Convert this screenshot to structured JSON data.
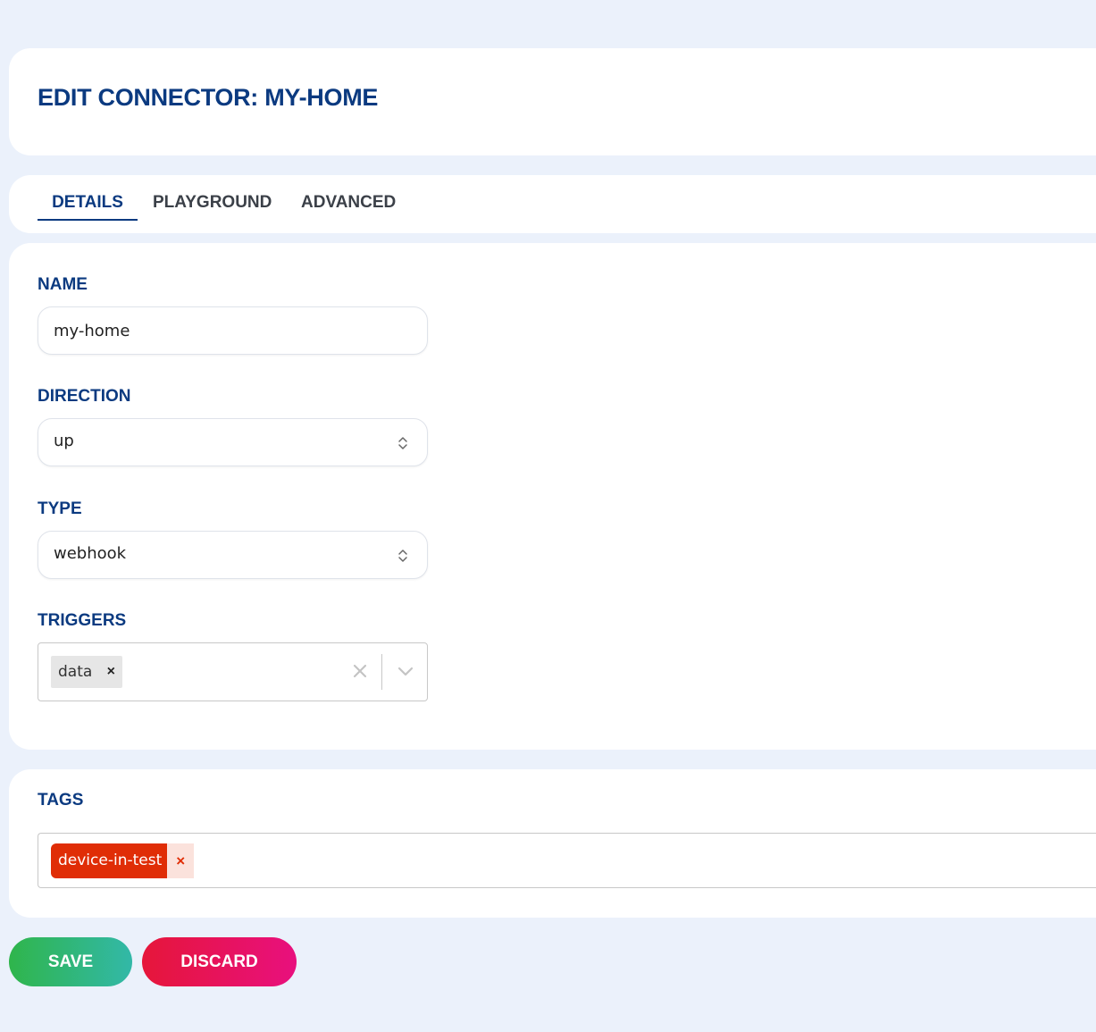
{
  "header": {
    "title": "EDIT CONNECTOR: MY-HOME"
  },
  "tabs": [
    {
      "label": "DETAILS",
      "active": true
    },
    {
      "label": "PLAYGROUND",
      "active": false
    },
    {
      "label": "ADVANCED",
      "active": false
    }
  ],
  "form": {
    "name": {
      "label": "NAME",
      "value": "my-home"
    },
    "direction": {
      "label": "DIRECTION",
      "value": "up"
    },
    "type": {
      "label": "TYPE",
      "value": "webhook"
    },
    "triggers": {
      "label": "TRIGGERS",
      "selected": [
        "data"
      ],
      "remove_glyph": "×"
    }
  },
  "tags": {
    "label": "TAGS",
    "items": [
      "device-in-test"
    ],
    "remove_glyph": "×"
  },
  "actions": {
    "save_label": "SAVE",
    "discard_label": "DISCARD"
  },
  "colors": {
    "title": "#0b3a80",
    "tag_chip": "#e02d06",
    "save_gradient": [
      "#2fb54b",
      "#32b8a8"
    ],
    "discard_gradient": [
      "#e6163a",
      "#e8107e"
    ]
  }
}
